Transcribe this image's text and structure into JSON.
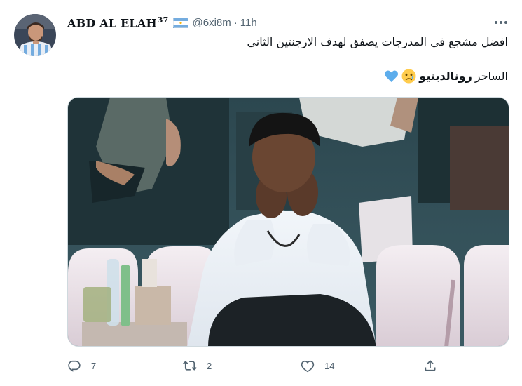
{
  "tweet": {
    "author": {
      "display_name": "ABD AL ELAH",
      "name_suffix": "37",
      "flag": "argentina-flag",
      "handle": "@6xi8m",
      "separator": "·",
      "time": "11h"
    },
    "text": {
      "line1": "افضل مشجع في المدرجات يصفق لهدف الارجنتين الثاني",
      "line2_prefix": "الساحر",
      "line2_bold": "رونالدينيو",
      "emojis": [
        "crying-face-emoji",
        "blue-heart-emoji"
      ]
    },
    "media": {
      "type": "photo"
    },
    "actions": {
      "replies": "7",
      "retweets": "2",
      "likes": "14"
    }
  },
  "colors": {
    "text_primary": "#0f1419",
    "text_secondary": "#536471",
    "border": "#cfd9de",
    "argentina_blue": "#74acdf"
  }
}
